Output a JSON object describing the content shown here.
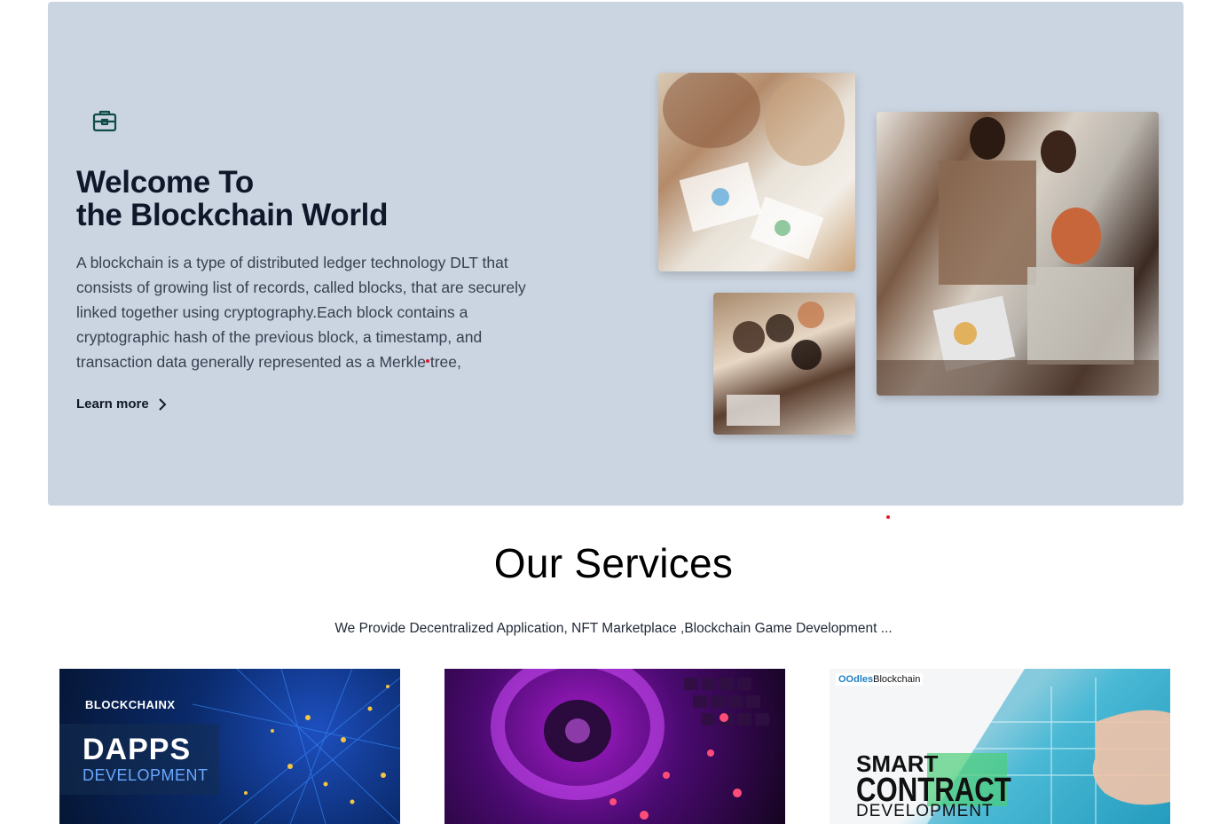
{
  "hero": {
    "icon": "briefcase-icon",
    "title_line1": "Welcome To",
    "title_line2": "the Blockchain World",
    "description": "A blockchain is a type of distributed ledger technology DLT that consists of growing list of records, called blocks, that are securely linked together using cryptography.Each block contains a cryptographic hash of the previous block, a timestamp, and transaction data generally represented as a Merkle tree,",
    "learn_more_label": "Learn more",
    "learn_more_icon": "chevron-right-icon",
    "background_color": "#cbd5e1"
  },
  "services": {
    "title": "Our Services",
    "subtitle": "We Provide Decentralized Application, NFT Marketplace ,Blockchain Game Development ...",
    "cards": [
      {
        "brand": "BLOCKCHAINX",
        "headline": "DAPPS",
        "subheadline": "DEVELOPMENT"
      },
      {
        "brand": "",
        "headline": "",
        "subheadline": ""
      },
      {
        "brand_prefix": "OO",
        "brand_highlight": "dles",
        "brand_suffix": "Blockchain",
        "line1": "SMART",
        "line2": "CONTRACT",
        "line3": "DEVELOPMENT"
      }
    ]
  }
}
